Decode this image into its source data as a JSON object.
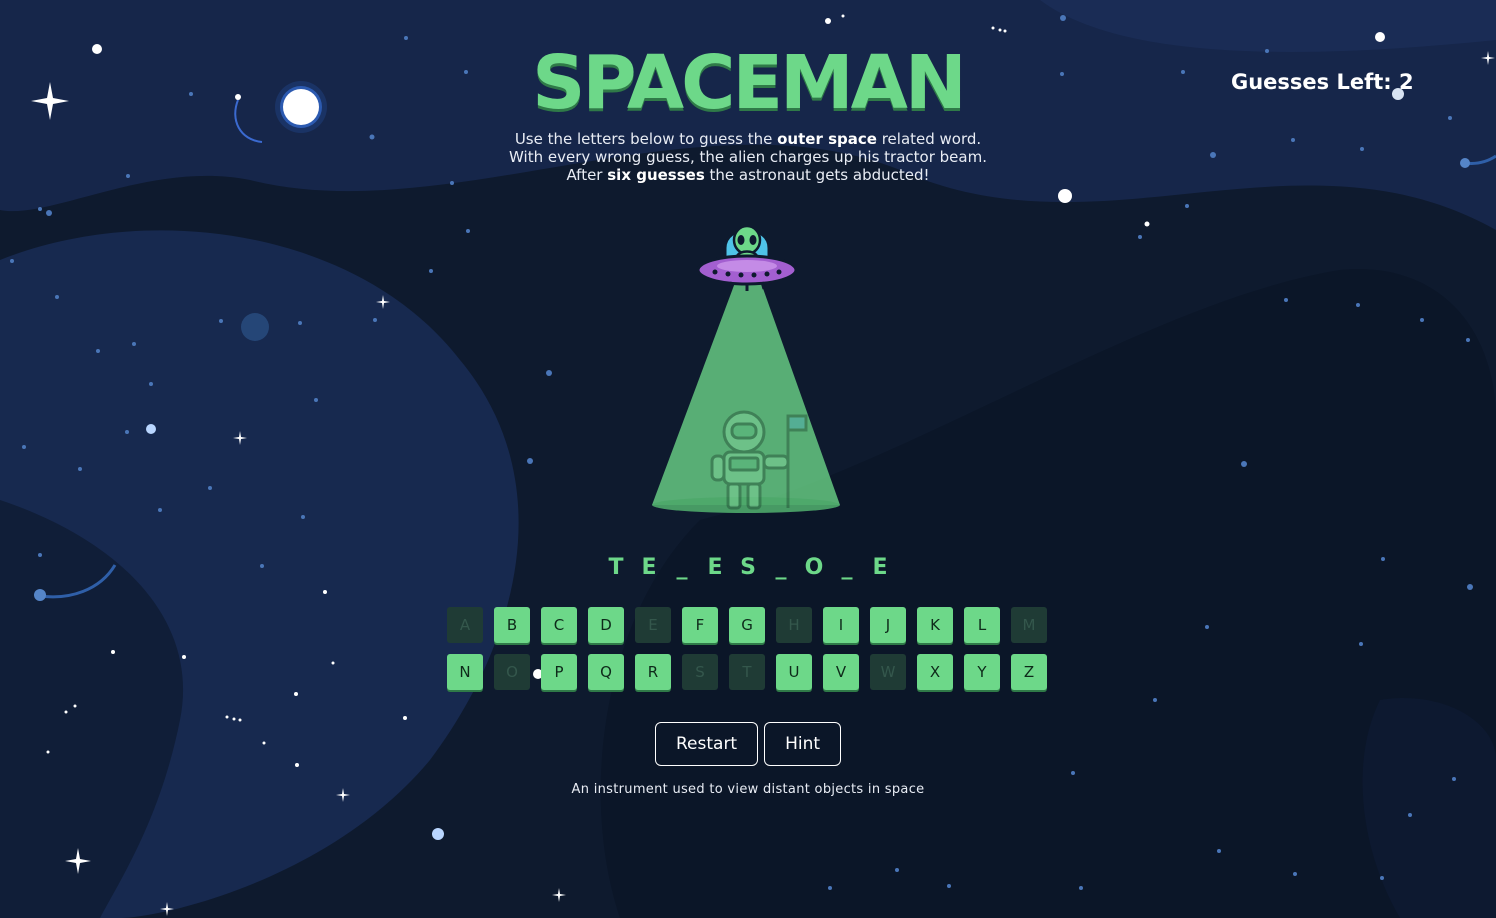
{
  "title": "SPACEMAN",
  "guesses_left": {
    "label": "Guesses Left:",
    "value": "2"
  },
  "instructions": {
    "line1_a": "Use the letters below to guess the ",
    "line1_b": "outer space",
    "line1_c": " related word.",
    "line2": "With every wrong guess, the alien charges up his tractor beam.",
    "line3_a": "After ",
    "line3_b": "six guesses",
    "line3_c": " the astronaut gets abducted!"
  },
  "word": [
    "T",
    "E",
    "_",
    "E",
    "S",
    "_",
    "O",
    "_",
    "E"
  ],
  "keyboard": {
    "row1": [
      {
        "letter": "A",
        "used": true
      },
      {
        "letter": "B",
        "used": false
      },
      {
        "letter": "C",
        "used": false
      },
      {
        "letter": "D",
        "used": false
      },
      {
        "letter": "E",
        "used": true
      },
      {
        "letter": "F",
        "used": false
      },
      {
        "letter": "G",
        "used": false
      },
      {
        "letter": "H",
        "used": true
      },
      {
        "letter": "I",
        "used": false
      },
      {
        "letter": "J",
        "used": false
      },
      {
        "letter": "K",
        "used": false
      },
      {
        "letter": "L",
        "used": false
      },
      {
        "letter": "M",
        "used": true
      }
    ],
    "row2": [
      {
        "letter": "N",
        "used": false
      },
      {
        "letter": "O",
        "used": true
      },
      {
        "letter": "P",
        "used": false
      },
      {
        "letter": "Q",
        "used": false
      },
      {
        "letter": "R",
        "used": false
      },
      {
        "letter": "S",
        "used": true
      },
      {
        "letter": "T",
        "used": true
      },
      {
        "letter": "U",
        "used": false
      },
      {
        "letter": "V",
        "used": false
      },
      {
        "letter": "W",
        "used": true
      },
      {
        "letter": "X",
        "used": false
      },
      {
        "letter": "Y",
        "used": false
      },
      {
        "letter": "Z",
        "used": false
      }
    ]
  },
  "buttons": {
    "restart": "Restart",
    "hint": "Hint"
  },
  "hint_text": "An instrument used to view distant objects in space",
  "icons": {
    "alien": "alien-ufo-icon",
    "astronaut": "astronaut-icon"
  },
  "colors": {
    "accent_green": "#6dd889",
    "used_key": "#1f3b35",
    "background": "#0e1a2e",
    "ufo_purple": "#a35fd0",
    "alien_cyan": "#4fc3e8"
  }
}
